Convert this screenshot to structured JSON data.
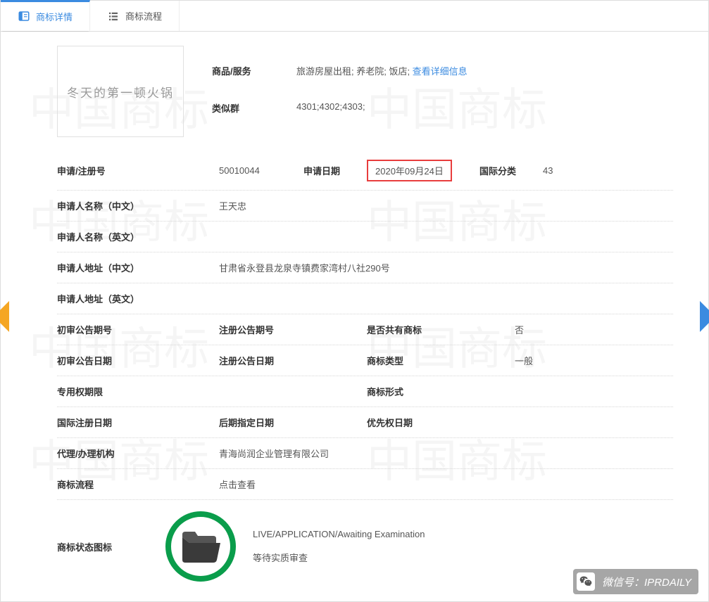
{
  "tabs": {
    "details": "商标详情",
    "process": "商标流程"
  },
  "trademark_name": "冬天的第一顿火锅",
  "goods_services": {
    "label": "商品/服务",
    "value": "旅游房屋出租; 养老院; 饭店; ",
    "more_link": "查看详细信息"
  },
  "similar_group": {
    "label": "类似群",
    "value": "4301;4302;4303;"
  },
  "fields": {
    "app_no": {
      "label": "申请/注册号",
      "value": "50010044"
    },
    "app_date": {
      "label": "申请日期",
      "value": "2020年09月24日"
    },
    "intl_class": {
      "label": "国际分类",
      "value": "43"
    },
    "applicant_cn": {
      "label": "申请人名称（中文）",
      "value": "王天忠"
    },
    "applicant_en": {
      "label": "申请人名称（英文）",
      "value": ""
    },
    "addr_cn": {
      "label": "申请人地址（中文）",
      "value": "甘肃省永登县龙泉寺镇费家湾村八社290号"
    },
    "addr_en": {
      "label": "申请人地址（英文）",
      "value": ""
    },
    "prelim_ann_no": {
      "label": "初审公告期号",
      "value": ""
    },
    "reg_ann_no": {
      "label": "注册公告期号",
      "value": ""
    },
    "co_owned": {
      "label": "是否共有商标",
      "value": "否"
    },
    "prelim_ann_date": {
      "label": "初审公告日期",
      "value": ""
    },
    "reg_ann_date": {
      "label": "注册公告日期",
      "value": ""
    },
    "tm_type": {
      "label": "商标类型",
      "value": "一般"
    },
    "exclusive_period": {
      "label": "专用权期限",
      "value": ""
    },
    "tm_form": {
      "label": "商标形式",
      "value": ""
    },
    "intl_reg_date": {
      "label": "国际注册日期",
      "value": ""
    },
    "later_desig_date": {
      "label": "后期指定日期",
      "value": ""
    },
    "priority_date": {
      "label": "优先权日期",
      "value": ""
    },
    "agency": {
      "label": "代理/办理机构",
      "value": "青海尚润企业管理有限公司"
    },
    "flow": {
      "label": "商标流程",
      "value": "点击查看"
    }
  },
  "status": {
    "label": "商标状态图标",
    "line1": "LIVE/APPLICATION/Awaiting Examination",
    "line2": "等待实质审查"
  },
  "footer": {
    "wx_label": "微信号：",
    "wx_id": "IPRDAILY"
  }
}
